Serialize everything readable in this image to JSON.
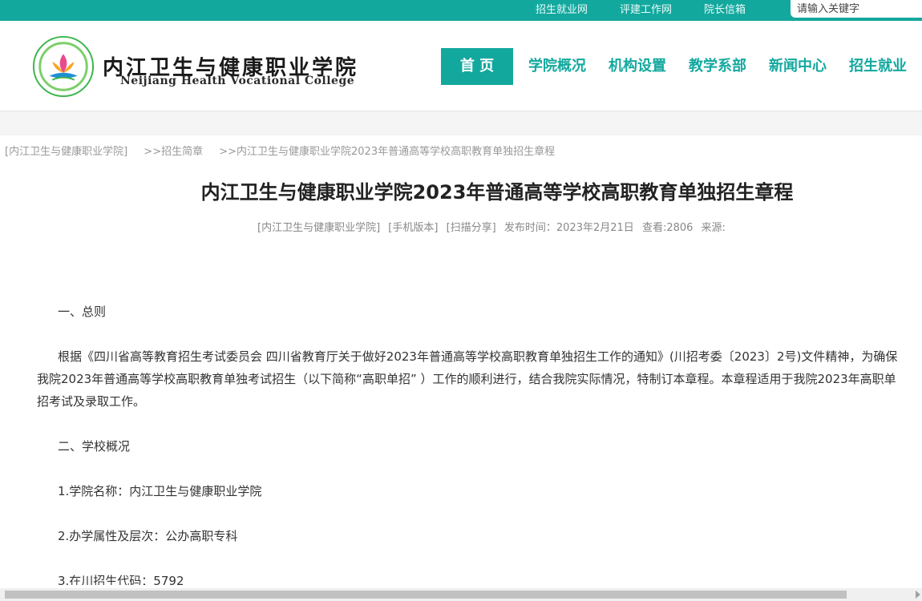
{
  "topbar": {
    "links": [
      "招生就业网",
      "评建工作网",
      "院长信箱"
    ],
    "search_placeholder": "请输入关键字"
  },
  "header": {
    "school_name_cn": "内江卫生与健康职业学院",
    "school_name_en": "Neijiang Health Vocational College"
  },
  "nav": {
    "items": [
      "首 页",
      "学院概况",
      "机构设置",
      "教学系部",
      "新闻中心",
      "招生就业"
    ]
  },
  "breadcrumb": [
    "[内江卫生与健康职业学院]",
    ">>招生简章",
    ">>内江卫生与健康职业学院2023年普通高等学校高职教育单独招生章程"
  ],
  "article": {
    "title": "内江卫生与健康职业学院2023年普通高等学校高职教育单独招生章程",
    "meta": {
      "site": "[内江卫生与健康职业学院]",
      "mobile": "[手机版本]",
      "scan": "[扫描分享]",
      "date": "发布时间：2023年2月21日",
      "views": "查看:2806",
      "source": "来源:"
    },
    "sections": {
      "s1": "一、总则",
      "p1_line1": "根据《四川省高等教育招生考试委员会 四川省教育厅关于做好2023年普通高等学校高职教育单独招生工作的通知》(川招考委〔2023〕2号)文件精神，为确保",
      "p1_line2": "我院2023年普通高等学校高职教育单独考试招生（以下简称“高职单招” ）工作的顺利进行，结合我院实际情况，特制订本章程。本章程适用于我院2023年高职单",
      "p1_line3": "招考试及录取工作。",
      "s2": "二、学校概况",
      "i1": "1.学院名称：内江卫生与健康职业学院",
      "i2": "2.办学属性及层次：公办高职专科",
      "i3": "3.在川招生代码：5792"
    }
  },
  "colors": {
    "brand": "#13a89e"
  }
}
